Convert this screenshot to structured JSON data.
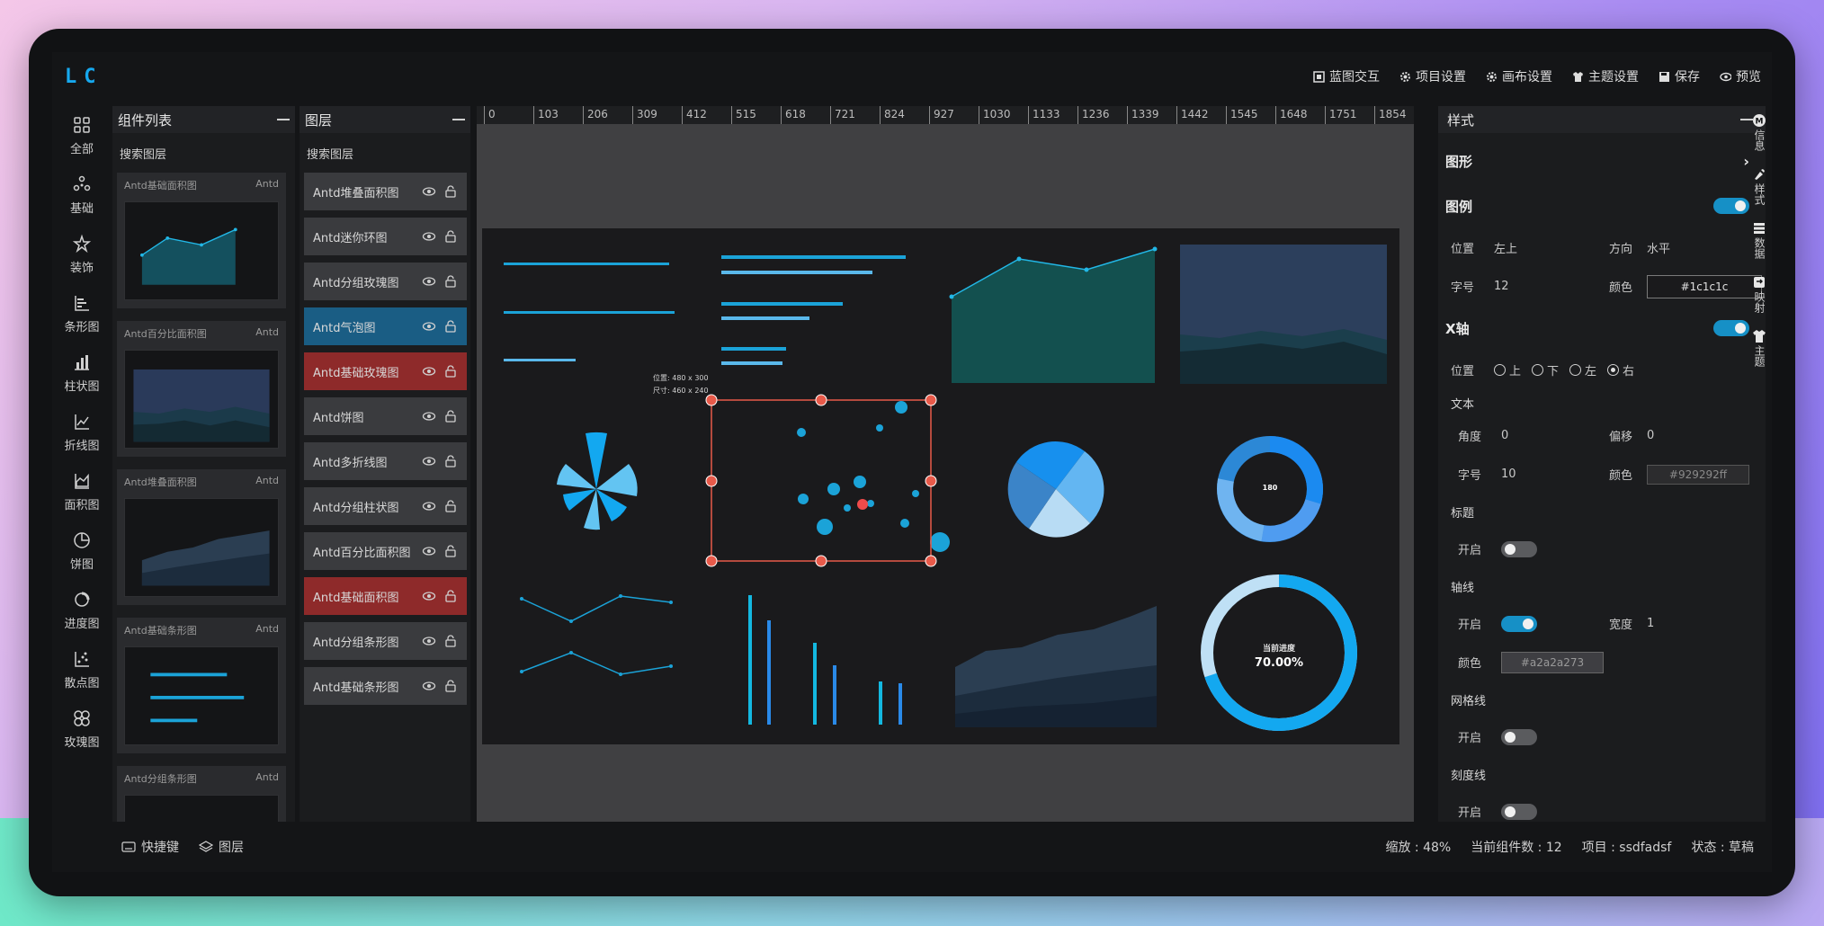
{
  "app": {
    "logo": "LC"
  },
  "toolbar": [
    {
      "label": "蓝图交互",
      "icon": "blueprint-icon"
    },
    {
      "label": "项目设置",
      "icon": "gear-icon"
    },
    {
      "label": "画布设置",
      "icon": "gear-icon"
    },
    {
      "label": "主题设置",
      "icon": "shirt-icon"
    },
    {
      "label": "保存",
      "icon": "save-icon"
    },
    {
      "label": "预览",
      "icon": "eye-icon"
    }
  ],
  "rail": [
    {
      "label": "全部",
      "icon": "grid-icon"
    },
    {
      "label": "基础",
      "icon": "nodes-icon"
    },
    {
      "label": "装饰",
      "icon": "star-icon"
    },
    {
      "label": "条形图",
      "icon": "bar-horizontal-icon"
    },
    {
      "label": "柱状图",
      "icon": "bar-vertical-icon"
    },
    {
      "label": "折线图",
      "icon": "line-chart-icon"
    },
    {
      "label": "面积图",
      "icon": "area-chart-icon"
    },
    {
      "label": "饼图",
      "icon": "pie-chart-icon"
    },
    {
      "label": "进度图",
      "icon": "progress-icon"
    },
    {
      "label": "散点图",
      "icon": "scatter-icon"
    },
    {
      "label": "玫瑰图",
      "icon": "rose-icon"
    }
  ],
  "components_panel": {
    "title": "组件列表",
    "search": "搜索图层",
    "cards": [
      {
        "name": "Antd基础面积图",
        "tag": "Antd"
      },
      {
        "name": "Antd百分比面积图",
        "tag": "Antd"
      },
      {
        "name": "Antd堆叠面积图",
        "tag": "Antd"
      },
      {
        "name": "Antd基础条形图",
        "tag": "Antd"
      },
      {
        "name": "Antd分组条形图",
        "tag": "Antd"
      }
    ]
  },
  "layers_panel": {
    "title": "图层",
    "search": "搜索图层",
    "items": [
      {
        "label": "Antd堆叠面积图",
        "state": "normal"
      },
      {
        "label": "Antd迷你环图",
        "state": "normal"
      },
      {
        "label": "Antd分组玫瑰图",
        "state": "normal"
      },
      {
        "label": "Antd气泡图",
        "state": "selected"
      },
      {
        "label": "Antd基础玫瑰图",
        "state": "locked"
      },
      {
        "label": "Antd饼图",
        "state": "normal"
      },
      {
        "label": "Antd多折线图",
        "state": "normal"
      },
      {
        "label": "Antd分组柱状图",
        "state": "normal"
      },
      {
        "label": "Antd百分比面积图",
        "state": "normal"
      },
      {
        "label": "Antd基础面积图",
        "state": "locked"
      },
      {
        "label": "Antd分组条形图",
        "state": "normal"
      },
      {
        "label": "Antd基础条形图",
        "state": "normal"
      }
    ]
  },
  "ruler": [
    "0",
    "103",
    "206",
    "309",
    "412",
    "515",
    "618",
    "721",
    "824",
    "927",
    "1030",
    "1133",
    "1236",
    "1339",
    "1442",
    "1545",
    "1648",
    "1751",
    "1854"
  ],
  "canvas": {
    "selection_position": "位置: 480 x 300",
    "selection_size": "尺寸: 460 x 240",
    "gauge_label": "当前进度",
    "gauge_value": "70.00%",
    "donut_center": "180"
  },
  "style_panel": {
    "title": "样式",
    "shape_section": "图形",
    "legend": {
      "title": "图例",
      "enabled": true,
      "position_label": "位置",
      "position_value": "左上",
      "direction_label": "方向",
      "direction_value": "水平",
      "size_label": "字号",
      "size_value": "12",
      "color_label": "颜色",
      "color_value": "#1c1c1c"
    },
    "xaxis": {
      "title": "X轴",
      "enabled": true,
      "position_label": "位置",
      "positions": [
        {
          "label": "上",
          "checked": false
        },
        {
          "label": "下",
          "checked": false
        },
        {
          "label": "左",
          "checked": false
        },
        {
          "label": "右",
          "checked": true
        }
      ],
      "text_label": "文本",
      "angle_label": "角度",
      "angle_value": "0",
      "offset_label": "偏移",
      "offset_value": "0",
      "size_label": "字号",
      "size_value": "10",
      "color_label": "颜色",
      "color_value": "#929292ff",
      "title_label": "标题",
      "title_open": "开启",
      "title_enabled": false,
      "axisline_label": "轴线",
      "axisline_open": "开启",
      "axisline_enabled": true,
      "width_label": "宽度",
      "width_value": "1",
      "axis_color_label": "颜色",
      "axis_color_value": "#a2a2a273",
      "grid_label": "网格线",
      "grid_open": "开启",
      "grid_enabled": false,
      "tick_label": "刻度线",
      "tick_open": "开启",
      "tick_enabled": false
    }
  },
  "right_rail": [
    {
      "label": "信息",
      "icon": "info-icon"
    },
    {
      "label": "样式",
      "icon": "brush-icon"
    },
    {
      "label": "数据",
      "icon": "database-icon"
    },
    {
      "label": "映射",
      "icon": "mapping-icon"
    },
    {
      "label": "主题",
      "icon": "shirt-icon"
    }
  ],
  "bottombar": {
    "shortcut": "快捷键",
    "layers": "图层",
    "zoom": "缩放 : 48%",
    "count": "当前组件数 : 12",
    "project": "项目 : ssdfadsf",
    "status": "状态 : 草稿"
  },
  "colors": {
    "accent": "#1690c6",
    "selected_layer": "#1a5d84",
    "locked_layer": "#8e2a2a",
    "chart_blue": "#13a8f0"
  }
}
